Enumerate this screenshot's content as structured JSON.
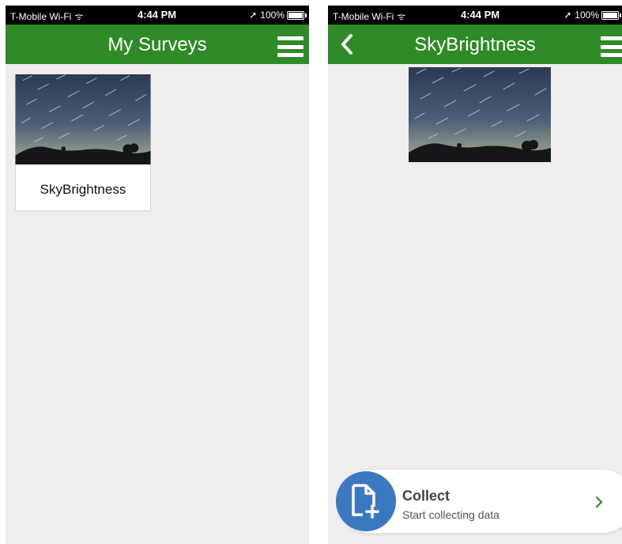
{
  "status_bar": {
    "carrier": "T-Mobile Wi-Fi",
    "time": "4:44 PM",
    "battery": "100%"
  },
  "left_screen": {
    "header": {
      "title": "My Surveys",
      "menu_icon": "hamburger-icon"
    },
    "surveys": [
      {
        "title": "SkyBrightness"
      }
    ]
  },
  "right_screen": {
    "header": {
      "title": "SkyBrightness",
      "back_icon": "back-chevron-icon",
      "menu_icon": "hamburger-icon"
    },
    "collect": {
      "label": "Collect",
      "subtitle": "Start collecting data",
      "icon": "add-document-icon",
      "chevron_icon": "chevron-right-icon"
    }
  },
  "colors": {
    "nav_green": "#2e8b27",
    "collect_blue": "#3a78c0",
    "background": "#eeeeee"
  }
}
